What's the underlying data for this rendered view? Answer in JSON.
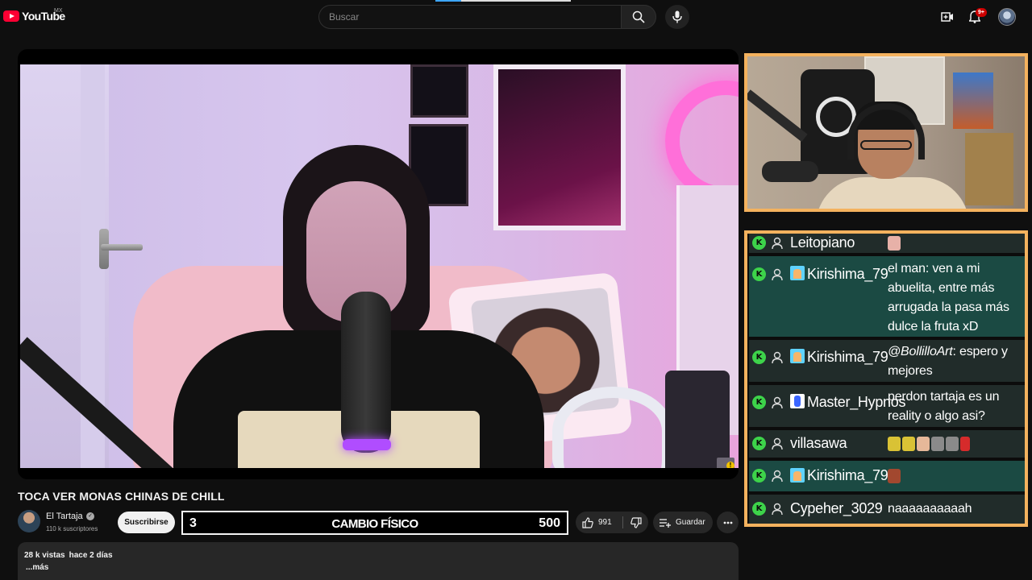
{
  "masthead": {
    "logo_text": "YouTube",
    "country_code": "MX",
    "search_placeholder": "Buscar",
    "notification_count": "9+",
    "icons": [
      "youtube-logo-icon",
      "search-icon",
      "mic-icon",
      "create-icon",
      "bell-icon",
      "avatar"
    ]
  },
  "video": {
    "title": "TOCA VER MONAS CHINAS DE CHILL",
    "channel_name": "El Tartaja",
    "subscribers": "110 k suscriptores",
    "subscribe_label": "Suscribirse",
    "likes": "991",
    "save_label": "Guardar",
    "overlay": {
      "left": "3",
      "center": "CAMBIO FÍSICO",
      "right": "500"
    }
  },
  "description": {
    "views": "28 k vistas",
    "date": "hace 2 días",
    "more": "...más"
  },
  "chat": {
    "messages": [
      {
        "user": "Leitopiano",
        "badge": "",
        "text": "",
        "emotes": [
          "pink"
        ]
      },
      {
        "user": "Kirishima_79",
        "badge": "kiri",
        "text": "el man: ven a mi abuelita, entre más arrugada la pasa más dulce la fruta xD",
        "emotes": []
      },
      {
        "user": "Kirishima_79",
        "badge": "kiri",
        "mention": "@BollilloArt",
        "text": ": espero y mejores",
        "emotes": []
      },
      {
        "user": "Master_Hypnos",
        "badge": "hyp",
        "text": "perdon tartaja es un reality o algo asi?",
        "emotes": []
      },
      {
        "user": "villasawa",
        "badge": "",
        "text": "",
        "emotes": [
          "yellow",
          "yellow",
          "thumb",
          "gray",
          "gray",
          "red"
        ]
      },
      {
        "user": "Kirishima_79",
        "badge": "kiri",
        "text": "",
        "emotes": [
          "brown"
        ]
      },
      {
        "user": "Cypeher_3029",
        "badge": "",
        "text": "naaaaaaaaaah",
        "emotes": []
      }
    ]
  },
  "colors": {
    "frame_accent": "#f4b25e",
    "chat_row": "#212c2a",
    "chat_row_alt": "#1b4a43",
    "kick_green": "#3dd34a",
    "youtube_red": "#ff0033"
  }
}
